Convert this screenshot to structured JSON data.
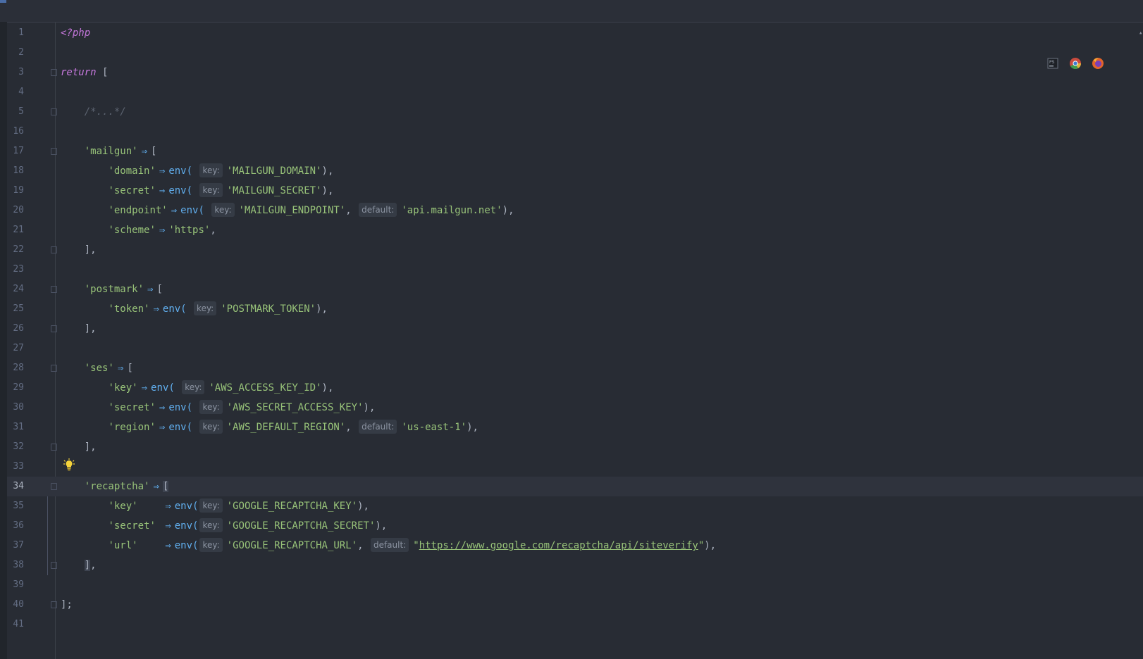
{
  "editor": {
    "browser_icons": [
      "phpstorm-icon",
      "chrome-icon",
      "firefox-icon"
    ],
    "php_open": "<?php",
    "return_kw": "return",
    "collapsed_comment": "/*...*/",
    "keys": {
      "mailgun": "'mailgun'",
      "domain": "'domain'",
      "secret": "'secret'",
      "endpoint": "'endpoint'",
      "scheme": "'scheme'",
      "postmark": "'postmark'",
      "token": "'token'",
      "ses": "'ses'",
      "key": "'key'",
      "region": "'region'",
      "recaptcha": "'recaptcha'",
      "url": "'url'"
    },
    "fn_env": "env(",
    "hint_key": "key:",
    "hint_default": "default:",
    "values": {
      "mailgun_domain": "'MAILGUN_DOMAIN'",
      "mailgun_secret": "'MAILGUN_SECRET'",
      "mailgun_endpoint": "'MAILGUN_ENDPOINT'",
      "mailgun_endpoint_default": "'api.mailgun.net'",
      "https": "'https'",
      "postmark_token": "'POSTMARK_TOKEN'",
      "aws_key": "'AWS_ACCESS_KEY_ID'",
      "aws_secret": "'AWS_SECRET_ACCESS_KEY'",
      "aws_region": "'AWS_DEFAULT_REGION'",
      "aws_region_default": "'us-east-1'",
      "recaptcha_key": "'GOOGLE_RECAPTCHA_KEY'",
      "recaptcha_secret": "'GOOGLE_RECAPTCHA_SECRET'",
      "recaptcha_url": "'GOOGLE_RECAPTCHA_URL'",
      "recaptcha_url_default": "https://www.google.com/recaptcha/api/siteverify"
    },
    "line_numbers": [
      "1",
      "2",
      "3",
      "4",
      "5",
      "16",
      "17",
      "18",
      "19",
      "20",
      "21",
      "22",
      "23",
      "24",
      "25",
      "26",
      "27",
      "28",
      "29",
      "30",
      "31",
      "32",
      "33",
      "34",
      "35",
      "36",
      "37",
      "38",
      "39",
      "40",
      "41"
    ],
    "current_line": "34",
    "colors": {
      "background": "#282c34",
      "keyword": "#c678dd",
      "string": "#98c379",
      "function": "#61afef",
      "comment": "#5c6370",
      "line_number": "#636d83",
      "bulb": "#f5d33b"
    }
  }
}
